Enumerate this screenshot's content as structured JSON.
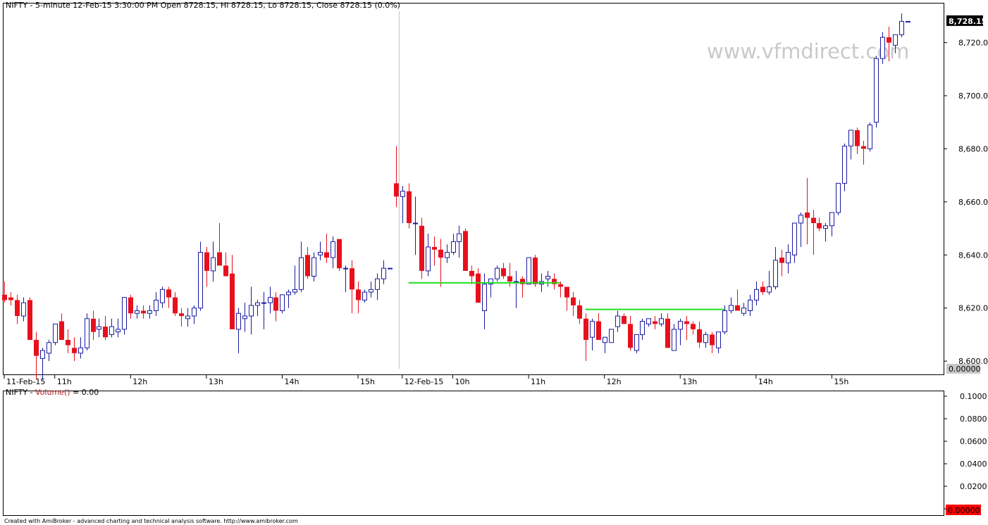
{
  "chart_data": [
    {
      "type": "candlestick",
      "title": "NIFTY - 5-minute 12-Feb-15 3:30:00 PM Open 8728.15, Hi 8728.15, Lo 8728.15, Close 8728.15 (0.0%)",
      "watermark": "www.vfmdirect.com",
      "ylim": [
        8595,
        8735
      ],
      "y_ticks": [
        "8,600.0",
        "8,620.0",
        "8,640.0",
        "8,660.0",
        "8,680.0",
        "8,700.0",
        "8,720.0"
      ],
      "y_tick_values": [
        8600,
        8620,
        8640,
        8660,
        8680,
        8700,
        8720
      ],
      "last_value_label": "8,728.15",
      "last_value": 8728.15,
      "bottom_value_label": "0.00000",
      "x_tick_labels": [
        "11-Feb-15",
        "11h",
        "12h",
        "13h",
        "14h",
        "15h",
        "12-Feb-15",
        "10h",
        "11h",
        "12h",
        "13h",
        "14h",
        "15h"
      ],
      "x_tick_bar_index": [
        0,
        8,
        20,
        32,
        44,
        56,
        63,
        71,
        83,
        95,
        107,
        119,
        131
      ],
      "day_separator_bar_index": 62.5,
      "grid": false,
      "colors": {
        "up": "#1a1aa0",
        "down": "#e8101c",
        "support_line": "#22dd22",
        "separator": "#c0c0c0"
      },
      "support_lines": [
        {
          "from_bar": 64,
          "to_bar": 88,
          "y": 8629.5
        },
        {
          "from_bar": 92,
          "to_bar": 114,
          "y": 8619.5
        }
      ],
      "candles": [
        [
          8625,
          8630,
          8622,
          8623
        ],
        [
          8624,
          8626,
          8621,
          8623
        ],
        [
          8623,
          8625,
          8614,
          8617
        ],
        [
          8617,
          8624,
          8615,
          8622
        ],
        [
          8623,
          8624,
          8608,
          8608
        ],
        [
          8608,
          8611,
          8593,
          8602
        ],
        [
          8601,
          8605,
          8593,
          8604
        ],
        [
          8603,
          8608,
          8600,
          8607
        ],
        [
          8607,
          8614,
          8606,
          8614
        ],
        [
          8615,
          8618,
          8608,
          8608
        ],
        [
          8608,
          8612,
          8603,
          8606
        ],
        [
          8605,
          8609,
          8600,
          8603
        ],
        [
          8603,
          8609,
          8601,
          8605
        ],
        [
          8605,
          8618,
          8604,
          8616
        ],
        [
          8616,
          8619,
          8608,
          8611
        ],
        [
          8612,
          8616,
          8609,
          8613
        ],
        [
          8613,
          8617,
          8608,
          8609
        ],
        [
          8610,
          8616,
          8609,
          8613
        ],
        [
          8611,
          8616,
          8609,
          8612
        ],
        [
          8612,
          8624,
          8610,
          8624
        ],
        [
          8624,
          8625,
          8616,
          8618
        ],
        [
          8618,
          8621,
          8616,
          8619
        ],
        [
          8619,
          8621,
          8616,
          8618
        ],
        [
          8618,
          8621,
          8616,
          8619
        ],
        [
          8619,
          8626,
          8617,
          8623
        ],
        [
          8622,
          8628,
          8620,
          8627
        ],
        [
          8627,
          8628,
          8620,
          8624
        ],
        [
          8624,
          8626,
          8617,
          8618
        ],
        [
          8618,
          8620,
          8613,
          8617
        ],
        [
          8616,
          8620,
          8613,
          8617
        ],
        [
          8617,
          8621,
          8614,
          8620
        ],
        [
          8620,
          8645,
          8619,
          8641
        ],
        [
          8641,
          8643,
          8628,
          8634
        ],
        [
          8634,
          8645,
          8630,
          8639
        ],
        [
          8641,
          8652,
          8638,
          8636
        ],
        [
          8636,
          8641,
          8632,
          8632
        ],
        [
          8633,
          8640,
          8617,
          8612
        ],
        [
          8612,
          8620,
          8603,
          8618
        ],
        [
          8616,
          8622,
          8611,
          8617
        ],
        [
          8617,
          8628,
          8610,
          8621
        ],
        [
          8621,
          8623,
          8617,
          8622
        ],
        [
          8622,
          8626,
          8612,
          8622
        ],
        [
          8622,
          8628,
          8618,
          8624
        ],
        [
          8624,
          8626,
          8615,
          8619
        ],
        [
          8619,
          8624,
          8618,
          8625
        ],
        [
          8625,
          8627,
          8620,
          8626
        ],
        [
          8626,
          8636,
          8625,
          8627
        ],
        [
          8627,
          8645,
          8626,
          8639
        ],
        [
          8640,
          8643,
          8631,
          8632
        ],
        [
          8632,
          8641,
          8630,
          8639
        ],
        [
          8640,
          8645,
          8638,
          8641
        ],
        [
          8641,
          8648,
          8637,
          8639
        ],
        [
          8639,
          8647,
          8635,
          8645
        ],
        [
          8646,
          8646,
          8634,
          8635
        ],
        [
          8635,
          8636,
          8626,
          8635
        ],
        [
          8635,
          8638,
          8618,
          8627
        ],
        [
          8627,
          8630,
          8618,
          8623
        ],
        [
          8623,
          8627,
          8622,
          8626
        ],
        [
          8626,
          8630,
          8624,
          8627
        ],
        [
          8627,
          8633,
          8623,
          8631
        ],
        [
          8631,
          8638,
          8629,
          8635
        ],
        [
          8635,
          8635,
          8635,
          8635
        ],
        [
          8667,
          8681,
          8658,
          8662
        ],
        [
          8662,
          8666,
          8652,
          8664
        ],
        [
          8664,
          8667,
          8650,
          8652
        ],
        [
          8652,
          8662,
          8640,
          8652
        ],
        [
          8651,
          8654,
          8631,
          8634
        ],
        [
          8634,
          8648,
          8632,
          8643
        ],
        [
          8643,
          8647,
          8636,
          8642
        ],
        [
          8642,
          8646,
          8628,
          8639
        ],
        [
          8639,
          8644,
          8637,
          8641
        ],
        [
          8641,
          8648,
          8640,
          8645
        ],
        [
          8645,
          8651,
          8639,
          8648
        ],
        [
          8649,
          8650,
          8634,
          8634
        ],
        [
          8634,
          8636,
          8629,
          8632
        ],
        [
          8633,
          8635,
          8625,
          8622
        ],
        [
          8619,
          8633,
          8612,
          8629
        ],
        [
          8629,
          8631,
          8624,
          8631
        ],
        [
          8631,
          8636,
          8630,
          8635
        ],
        [
          8635,
          8637,
          8631,
          8632
        ],
        [
          8632,
          8637,
          8628,
          8630
        ],
        [
          8630,
          8634,
          8620,
          8630
        ],
        [
          8631,
          8632,
          8624,
          8629
        ],
        [
          8629,
          8639,
          8629,
          8639
        ],
        [
          8639,
          8640,
          8628,
          8629
        ],
        [
          8629,
          8633,
          8626,
          8630
        ],
        [
          8631,
          8634,
          8628,
          8632
        ],
        [
          8631,
          8633,
          8627,
          8629
        ],
        [
          8629,
          8630,
          8624,
          8628
        ],
        [
          8628,
          8626,
          8619,
          8624
        ],
        [
          8624,
          8626,
          8617,
          8621
        ],
        [
          8621,
          8623,
          8614,
          8616
        ],
        [
          8616,
          8618,
          8600,
          8608
        ],
        [
          8609,
          8616,
          8604,
          8615
        ],
        [
          8615,
          8618,
          8609,
          8608
        ],
        [
          8607,
          8609,
          8603,
          8609
        ],
        [
          8607,
          8612,
          8607,
          8612
        ],
        [
          8613,
          8619,
          8611,
          8617
        ],
        [
          8617,
          8618,
          8614,
          8614
        ],
        [
          8614,
          8617,
          8604,
          8605
        ],
        [
          8604,
          8609,
          8603,
          8610
        ],
        [
          8610,
          8616,
          8608,
          8615
        ],
        [
          8614,
          8616,
          8613,
          8616
        ],
        [
          8615,
          8617,
          8612,
          8614
        ],
        [
          8614,
          8618,
          8613,
          8616
        ],
        [
          8616,
          8618,
          8605,
          8605
        ],
        [
          8604,
          8614,
          8604,
          8612
        ],
        [
          8612,
          8616,
          8606,
          8615
        ],
        [
          8615,
          8617,
          8608,
          8614
        ],
        [
          8614,
          8615,
          8610,
          8612
        ],
        [
          8612,
          8615,
          8605,
          8607
        ],
        [
          8607,
          8611,
          8605,
          8610
        ],
        [
          8610,
          8611,
          8603,
          8606
        ],
        [
          8605,
          8611,
          8603,
          8611
        ],
        [
          8611,
          8621,
          8610,
          8619
        ],
        [
          8619,
          8624,
          8618,
          8621
        ],
        [
          8621,
          8627,
          8619,
          8619
        ],
        [
          8618,
          8622,
          8617,
          8620
        ],
        [
          8619,
          8625,
          8617,
          8623
        ],
        [
          8623,
          8630,
          8621,
          8627
        ],
        [
          8628,
          8630,
          8625,
          8626
        ],
        [
          8626,
          8634,
          8625,
          8628
        ],
        [
          8628,
          8643,
          8627,
          8638
        ],
        [
          8639,
          8642,
          8632,
          8637
        ],
        [
          8637,
          8644,
          8633,
          8641
        ],
        [
          8640,
          8648,
          8637,
          8652
        ],
        [
          8652,
          8656,
          8643,
          8655
        ],
        [
          8656,
          8669,
          8644,
          8654
        ],
        [
          8654,
          8657,
          8640,
          8652
        ],
        [
          8652,
          8654,
          8649,
          8650
        ],
        [
          8650,
          8652,
          8645,
          8651
        ],
        [
          8651,
          8655,
          8647,
          8656
        ],
        [
          8656,
          8667,
          8655,
          8667
        ],
        [
          8667,
          8682,
          8664,
          8681
        ],
        [
          8681,
          8686,
          8676,
          8687
        ],
        [
          8687,
          8688,
          8678,
          8681
        ],
        [
          8681,
          8683,
          8674,
          8680
        ],
        [
          8680,
          8690,
          8679,
          8689
        ],
        [
          8690,
          8715,
          8688,
          8714
        ],
        [
          8714,
          8724,
          8712,
          8722
        ],
        [
          8722,
          8726,
          8713,
          8720
        ],
        [
          8719,
          8721,
          8716,
          8723
        ],
        [
          8723,
          8731,
          8722,
          8728
        ],
        [
          8728,
          8728,
          8728,
          8728
        ]
      ]
    },
    {
      "type": "bar",
      "title_prefix": "NIFTY - ",
      "series_name": "Volume()",
      "title_suffix": " = 0.00",
      "y_ticks": [
        "0.1000",
        "0.0800",
        "0.0600",
        "0.0400",
        "0.0200",
        "0"
      ],
      "y_tick_values": [
        0.1,
        0.08,
        0.06,
        0.04,
        0.02,
        0
      ],
      "ylim": [
        0,
        0.1
      ],
      "last_value_label": "0.00000",
      "values": []
    }
  ],
  "footer": "Created with AmiBroker - advanced charting and technical analysis software. http://www.amibroker.com"
}
